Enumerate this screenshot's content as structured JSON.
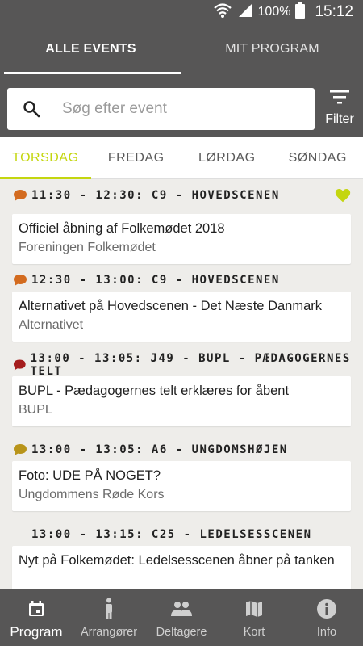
{
  "status": {
    "battery": "100%",
    "time": "15:12"
  },
  "top_tabs": [
    {
      "label": "ALLE EVENTS",
      "active": true
    },
    {
      "label": "MIT PROGRAM",
      "active": false
    }
  ],
  "search": {
    "placeholder": "Søg efter event"
  },
  "filter": {
    "label": "Filter"
  },
  "day_tabs": [
    {
      "label": "TORSDAG",
      "active": true
    },
    {
      "label": "FREDAG",
      "active": false
    },
    {
      "label": "LØRDAG",
      "active": false
    },
    {
      "label": "SØNDAG",
      "active": false
    }
  ],
  "events": [
    {
      "time_place": "11:30 - 12:30: C9 - HOVEDSCENEN",
      "title": "Officiel åbning af Folkemødet 2018",
      "organizer": "Foreningen Folkemødet",
      "bubble_color": "#d36b1f",
      "favorite": true
    },
    {
      "time_place": "12:30 - 13:00: C9 - HOVEDSCENEN",
      "title": "Alternativet på Hovedscenen - Det Næste Danmark",
      "organizer": "Alternativet",
      "bubble_color": "#d36b1f",
      "favorite": false
    },
    {
      "time_place": "13:00 - 13:05: J49 - BUPL - PÆDAGOGERNES TELT",
      "title": "BUPL - Pædagogernes telt erklæres for åbent",
      "organizer": "BUPL",
      "bubble_color": "#a51d1d",
      "favorite": false
    },
    {
      "time_place": "13:00 - 13:05: A6 - UNGDOMSHØJEN",
      "title": "Foto: UDE PÅ NOGET?",
      "organizer": "Ungdommens Røde Kors",
      "bubble_color": "#b8941a",
      "favorite": false
    },
    {
      "time_place": "13:00 - 13:15: C25 - LEDELSESSCENEN",
      "title": "Nyt på Folkemødet: Ledelsesscenen åbner på tanken",
      "organizer": "",
      "bubble_color": "",
      "favorite": false
    }
  ],
  "colors": {
    "header": "#575656",
    "accent": "#c4d60f",
    "background": "#eeedea"
  },
  "bottom_nav": [
    {
      "label": "Program",
      "icon": "calendar-icon",
      "active": true
    },
    {
      "label": "Arrangører",
      "icon": "person-icon",
      "active": false
    },
    {
      "label": "Deltagere",
      "icon": "people-icon",
      "active": false
    },
    {
      "label": "Kort",
      "icon": "map-icon",
      "active": false
    },
    {
      "label": "Info",
      "icon": "info-icon",
      "active": false
    }
  ]
}
